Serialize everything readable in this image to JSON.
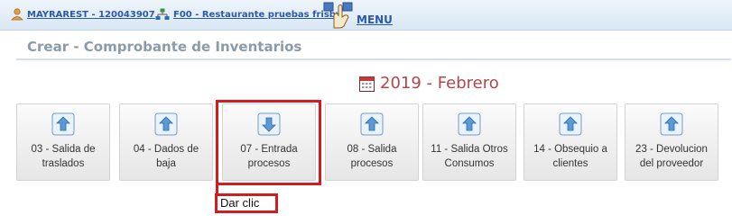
{
  "topbar": {
    "user_label": "MAYRAREST - 120043907",
    "branch_label": "F00 - Restaurante pruebas frisby",
    "menu_label": "MENU"
  },
  "page": {
    "title": "Crear - Comprobante de Inventarios",
    "period": "2019 - Febrero"
  },
  "tiles": [
    {
      "line1": "03 - Salida de",
      "line2": "traslados",
      "icon": "arrow-up-icon"
    },
    {
      "line1": "04 - Dados de",
      "line2": "baja",
      "icon": "arrow-up-icon"
    },
    {
      "line1": "07 - Entrada",
      "line2": "procesos",
      "icon": "arrow-down-icon"
    },
    {
      "line1": "08 - Salida",
      "line2": "procesos",
      "icon": "arrow-up-icon"
    },
    {
      "line1": "11 - Salida Otros",
      "line2": "Consumos",
      "icon": "arrow-up-icon"
    },
    {
      "line1": "14 - Obsequio a",
      "line2": "clientes",
      "icon": "arrow-up-icon"
    },
    {
      "line1": "23 - Devolucion",
      "line2": "del proveedor",
      "icon": "arrow-up-icon"
    }
  ],
  "annotation": {
    "callout_text": "Dar clic",
    "highlight_color": "#d21c22"
  },
  "colors": {
    "title": "#8a9bab",
    "period": "#b2474a",
    "link": "#2a5aa8"
  }
}
